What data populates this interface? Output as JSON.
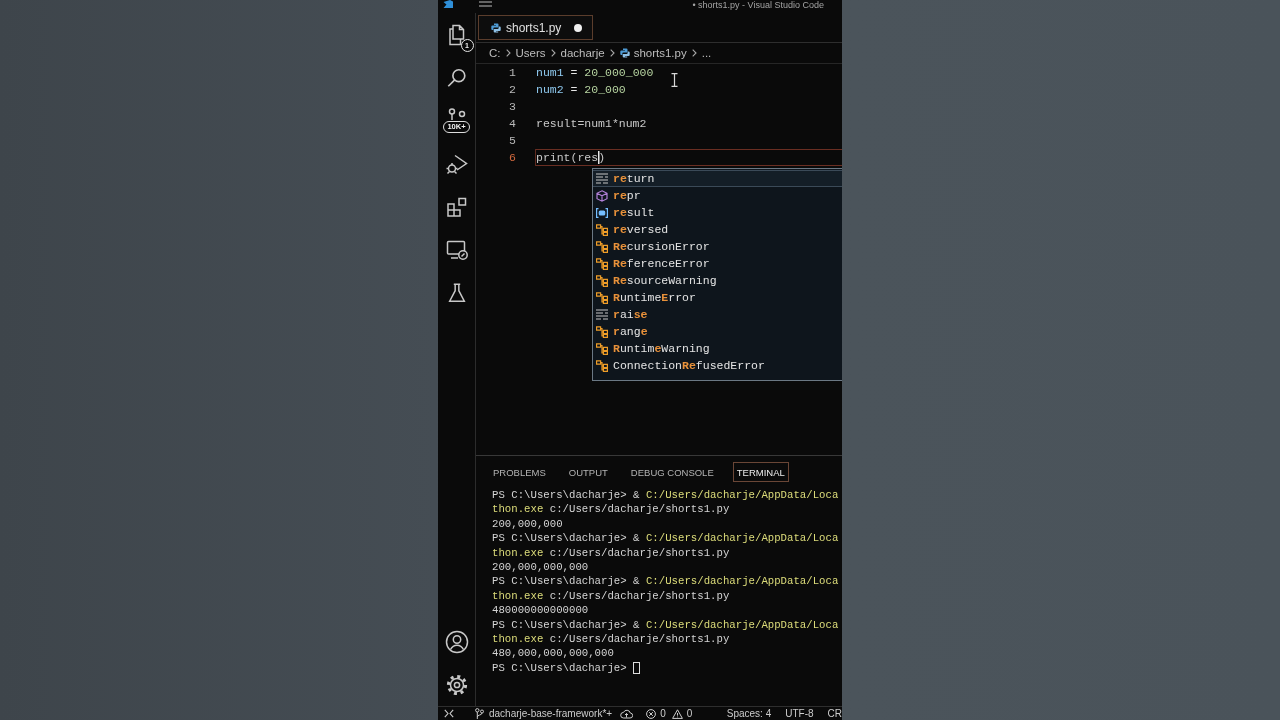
{
  "window": {
    "title": "• shorts1.py - Visual Studio Code"
  },
  "activity_bar": {
    "explorer_badge": "1",
    "source_control_badge": "10K+"
  },
  "tabs": [
    {
      "label": "shorts1.py",
      "selected": true,
      "modified": true
    }
  ],
  "breadcrumb": [
    {
      "label": "C:",
      "kind": "text"
    },
    {
      "label": "Users",
      "kind": "text"
    },
    {
      "label": "dacharje",
      "kind": "text"
    },
    {
      "label": "shorts1.py",
      "kind": "file"
    },
    {
      "label": "...",
      "kind": "text"
    }
  ],
  "code": {
    "lines": [
      {
        "number": "1",
        "current": false,
        "tokens": [
          {
            "text": "num1",
            "kind": "variable"
          },
          {
            "text": " = ",
            "kind": "operator"
          },
          {
            "text": "20_000_000",
            "kind": "number"
          }
        ]
      },
      {
        "number": "2",
        "current": false,
        "tokens": [
          {
            "text": "num2",
            "kind": "variable"
          },
          {
            "text": " = ",
            "kind": "operator"
          },
          {
            "text": "20_000",
            "kind": "number"
          }
        ]
      },
      {
        "number": "3",
        "current": false
      },
      {
        "number": "4",
        "current": false,
        "tokens": [
          {
            "text": "result=num1*num2",
            "kind": "plain"
          }
        ]
      },
      {
        "number": "5",
        "current": false
      },
      {
        "number": "6",
        "current": true,
        "tokens": [
          {
            "text": "print(res",
            "kind": "plain"
          },
          {
            "kind": "caret"
          },
          {
            "text": ")",
            "kind": "plain"
          }
        ]
      }
    ]
  },
  "suggestions": {
    "items": [
      {
        "label": "**re**turn",
        "kind": "keyword",
        "selected": true
      },
      {
        "label": "**re**pr",
        "kind": "function",
        "selected": false
      },
      {
        "label": "**re**sult",
        "kind": "variable",
        "selected": false
      },
      {
        "label": "**re**versed",
        "kind": "class",
        "selected": false
      },
      {
        "label": "**Re**cursionError",
        "kind": "class",
        "selected": false
      },
      {
        "label": "**Re**ferenceError",
        "kind": "class",
        "selected": false
      },
      {
        "label": "**Re**sourceWarning",
        "kind": "class",
        "selected": false
      },
      {
        "label": "**R**untime**E**rror",
        "kind": "class",
        "selected": false
      },
      {
        "label": "**r**ai**se**",
        "kind": "keyword",
        "selected": false
      },
      {
        "label": "**r**ang**e**",
        "kind": "class",
        "selected": false
      },
      {
        "label": "**R**untim**e**Warning",
        "kind": "class",
        "selected": false
      },
      {
        "label": "Connection**Re**fusedError",
        "kind": "class",
        "selected": false
      }
    ]
  },
  "panel": {
    "tabs": [
      {
        "label": "PROBLEMS",
        "selected": false
      },
      {
        "label": "OUTPUT",
        "selected": false
      },
      {
        "label": "DEBUG CONSOLE",
        "selected": false
      },
      {
        "label": "TERMINAL",
        "selected": true
      }
    ],
    "terminal": {
      "lines": [
        {
          "segments": [
            {
              "text": "PS C:\\Users\\dacharje> & ",
              "kind": "plain"
            },
            {
              "text": "C:/Users/dacharje/AppData/Loca",
              "kind": "command"
            }
          ]
        },
        {
          "segments": [
            {
              "text": "thon.exe",
              "kind": "command"
            },
            {
              "text": " c:/Users/dacharje/shorts1.py",
              "kind": "plain"
            }
          ]
        },
        {
          "segments": [
            {
              "text": "200,000,000",
              "kind": "plain"
            }
          ]
        },
        {
          "segments": [
            {
              "text": "PS C:\\Users\\dacharje> & ",
              "kind": "plain"
            },
            {
              "text": "C:/Users/dacharje/AppData/Loca",
              "kind": "command"
            }
          ]
        },
        {
          "segments": [
            {
              "text": "thon.exe",
              "kind": "command"
            },
            {
              "text": " c:/Users/dacharje/shorts1.py",
              "kind": "plain"
            }
          ]
        },
        {
          "segments": [
            {
              "text": "200,000,000,000",
              "kind": "plain"
            }
          ]
        },
        {
          "segments": [
            {
              "text": "PS C:\\Users\\dacharje> & ",
              "kind": "plain"
            },
            {
              "text": "C:/Users/dacharje/AppData/Loca",
              "kind": "command"
            }
          ]
        },
        {
          "segments": [
            {
              "text": "thon.exe",
              "kind": "command"
            },
            {
              "text": " c:/Users/dacharje/shorts1.py",
              "kind": "plain"
            }
          ]
        },
        {
          "segments": [
            {
              "text": "480000000000000",
              "kind": "plain"
            }
          ]
        },
        {
          "segments": [
            {
              "text": "PS C:\\Users\\dacharje> & ",
              "kind": "plain"
            },
            {
              "text": "C:/Users/dacharje/AppData/Loca",
              "kind": "command"
            }
          ]
        },
        {
          "segments": [
            {
              "text": "thon.exe",
              "kind": "command"
            },
            {
              "text": " c:/Users/dacharje/shorts1.py",
              "kind": "plain"
            }
          ]
        },
        {
          "segments": [
            {
              "text": "480,000,000,000,000",
              "kind": "plain"
            }
          ]
        },
        {
          "segments": [
            {
              "text": "PS C:\\Users\\dacharje> ",
              "kind": "plain"
            },
            {
              "kind": "cursor"
            }
          ]
        }
      ]
    }
  },
  "status_bar": {
    "branch": "dacharje-base-framework*+",
    "errors": "0",
    "warnings": "0",
    "items": [
      "Spaces: 4",
      "UTF-8",
      "CR"
    ]
  }
}
